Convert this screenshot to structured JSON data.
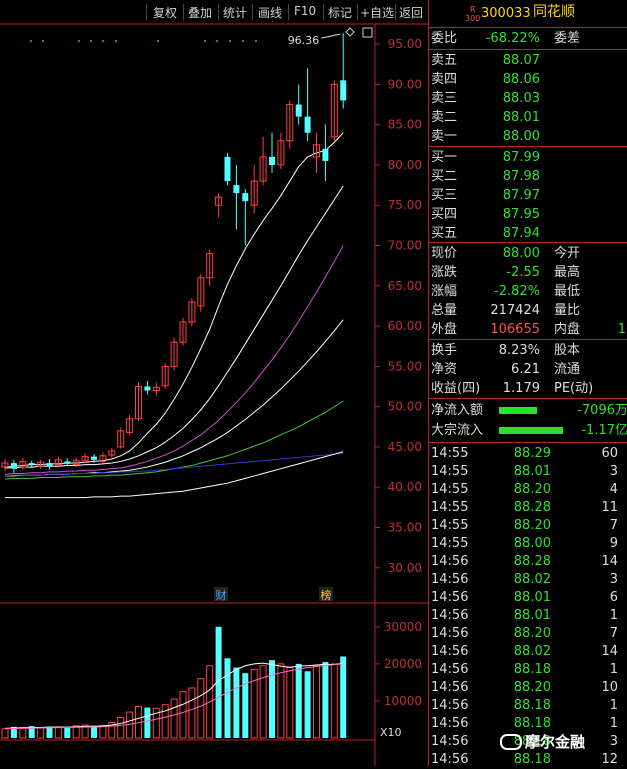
{
  "toolbar": {
    "buttons": [
      "复权",
      "叠加",
      "统计",
      "画线",
      "F10",
      "标记",
      "+自选",
      "返回"
    ]
  },
  "stock": {
    "badge_top": "R",
    "badge_bottom": "300",
    "code": "300033",
    "name": "同花顺"
  },
  "quote": {
    "ratio_label": "委比",
    "ratio_value": "-68.22%",
    "diff_label": "委差",
    "asks": [
      {
        "label": "卖五",
        "price": "88.07"
      },
      {
        "label": "卖四",
        "price": "88.06"
      },
      {
        "label": "卖三",
        "price": "88.03"
      },
      {
        "label": "卖二",
        "price": "88.01"
      },
      {
        "label": "卖一",
        "price": "88.00"
      }
    ],
    "bids": [
      {
        "label": "买一",
        "price": "87.99"
      },
      {
        "label": "买二",
        "price": "87.98"
      },
      {
        "label": "买三",
        "price": "87.97"
      },
      {
        "label": "买四",
        "price": "87.95"
      },
      {
        "label": "买五",
        "price": "87.94"
      }
    ],
    "stats": [
      {
        "label": "现价",
        "value": "88.00",
        "color": "#2ee02e",
        "label2": "今开",
        "value2": ""
      },
      {
        "label": "涨跌",
        "value": "-2.55",
        "color": "#2ee02e",
        "label2": "最高",
        "value2": ""
      },
      {
        "label": "涨幅",
        "value": "-2.82%",
        "color": "#2ee02e",
        "label2": "最低",
        "value2": ""
      },
      {
        "label": "总量",
        "value": "217424",
        "color": "#dddddd",
        "label2": "量比",
        "value2": ""
      },
      {
        "label": "外盘",
        "value": "106655",
        "color": "#ff5050",
        "label2": "内盘",
        "value2": "1"
      }
    ],
    "finance": [
      {
        "label": "换手",
        "value": "8.23%",
        "label2": "股本"
      },
      {
        "label": "净资",
        "value": "6.21",
        "label2": "流通"
      },
      {
        "label": "收益(四)",
        "value": "1.179",
        "label2": "PE(动)"
      }
    ],
    "flows": [
      {
        "label": "净流入额",
        "value": "-7096万"
      },
      {
        "label": "大宗流入",
        "value": "-1.17亿"
      }
    ]
  },
  "ticks": [
    {
      "time": "14:55",
      "price": "88.29",
      "vol": "60"
    },
    {
      "time": "14:55",
      "price": "88.01",
      "vol": "3"
    },
    {
      "time": "14:55",
      "price": "88.20",
      "vol": "4"
    },
    {
      "time": "14:55",
      "price": "88.28",
      "vol": "11"
    },
    {
      "time": "14:55",
      "price": "88.20",
      "vol": "7"
    },
    {
      "time": "14:55",
      "price": "88.00",
      "vol": "9"
    },
    {
      "time": "14:56",
      "price": "88.28",
      "vol": "14"
    },
    {
      "time": "14:56",
      "price": "88.02",
      "vol": "3"
    },
    {
      "time": "14:56",
      "price": "88.01",
      "vol": "6"
    },
    {
      "time": "14:56",
      "price": "88.01",
      "vol": "1"
    },
    {
      "time": "14:56",
      "price": "88.20",
      "vol": "7"
    },
    {
      "time": "14:56",
      "price": "88.02",
      "vol": "14"
    },
    {
      "time": "14:56",
      "price": "88.18",
      "vol": "1"
    },
    {
      "time": "14:56",
      "price": "88.20",
      "vol": "10"
    },
    {
      "time": "14:56",
      "price": "88.18",
      "vol": "1"
    },
    {
      "time": "14:56",
      "price": "88.18",
      "vol": "1"
    },
    {
      "time": "14:56",
      "price": "88.18",
      "vol": "3"
    },
    {
      "time": "14:56",
      "price": "88.18",
      "vol": "12"
    }
  ],
  "chart_data": [
    {
      "type": "candlestick",
      "price_axis_ticks": [
        "95.00",
        "90.00",
        "85.00",
        "80.00",
        "75.00",
        "70.00",
        "65.00",
        "60.00",
        "55.00",
        "50.00",
        "45.00",
        "40.00",
        "35.00",
        "30.00"
      ],
      "ylim": [
        26.0,
        97.0
      ],
      "max_label": "96.36",
      "event_markers": [
        "财",
        "榜"
      ],
      "candles": [
        {
          "o": 42.5,
          "c": 43.0,
          "h": 43.5,
          "l": 42.0
        },
        {
          "o": 43.0,
          "c": 42.3,
          "h": 43.4,
          "l": 41.8
        },
        {
          "o": 42.5,
          "c": 43.2,
          "h": 43.6,
          "l": 42.1
        },
        {
          "o": 43.0,
          "c": 42.8,
          "h": 43.3,
          "l": 42.4
        },
        {
          "o": 42.6,
          "c": 43.1,
          "h": 43.4,
          "l": 42.3
        },
        {
          "o": 43.0,
          "c": 42.6,
          "h": 43.5,
          "l": 42.2
        },
        {
          "o": 42.8,
          "c": 43.4,
          "h": 43.8,
          "l": 42.5
        },
        {
          "o": 43.2,
          "c": 42.9,
          "h": 43.6,
          "l": 42.6
        },
        {
          "o": 42.8,
          "c": 43.3,
          "h": 43.7,
          "l": 42.5
        },
        {
          "o": 43.3,
          "c": 43.8,
          "h": 44.2,
          "l": 43.0
        },
        {
          "o": 43.8,
          "c": 43.4,
          "h": 44.1,
          "l": 43.0
        },
        {
          "o": 43.2,
          "c": 43.9,
          "h": 44.3,
          "l": 43.0
        },
        {
          "o": 44.0,
          "c": 44.5,
          "h": 44.9,
          "l": 43.7
        },
        {
          "o": 45.0,
          "c": 47.0,
          "h": 47.4,
          "l": 44.8
        },
        {
          "o": 46.8,
          "c": 48.5,
          "h": 49.0,
          "l": 46.5
        },
        {
          "o": 48.5,
          "c": 52.5,
          "h": 53.0,
          "l": 48.2
        },
        {
          "o": 52.5,
          "c": 52.0,
          "h": 53.2,
          "l": 51.5
        },
        {
          "o": 52.0,
          "c": 52.4,
          "h": 53.0,
          "l": 51.4
        },
        {
          "o": 52.6,
          "c": 55.0,
          "h": 55.4,
          "l": 52.2
        },
        {
          "o": 55.0,
          "c": 58.0,
          "h": 58.6,
          "l": 54.5
        },
        {
          "o": 58.0,
          "c": 60.5,
          "h": 61.0,
          "l": 57.6
        },
        {
          "o": 60.5,
          "c": 63.0,
          "h": 63.5,
          "l": 60.0
        },
        {
          "o": 62.5,
          "c": 66.0,
          "h": 66.5,
          "l": 61.8
        },
        {
          "o": 66.0,
          "c": 69.0,
          "h": 69.5,
          "l": 65.0
        },
        {
          "o": 75.0,
          "c": 76.0,
          "h": 76.5,
          "l": 73.5
        },
        {
          "o": 81.0,
          "c": 78.0,
          "h": 81.5,
          "l": 77.5
        },
        {
          "o": 77.5,
          "c": 76.5,
          "h": 80.0,
          "l": 72.0
        },
        {
          "o": 76.5,
          "c": 75.5,
          "h": 77.0,
          "l": 70.0
        },
        {
          "o": 75.0,
          "c": 78.0,
          "h": 80.0,
          "l": 74.0
        },
        {
          "o": 78.0,
          "c": 81.0,
          "h": 83.5,
          "l": 77.5
        },
        {
          "o": 81.0,
          "c": 80.0,
          "h": 84.0,
          "l": 79.0
        },
        {
          "o": 80.0,
          "c": 83.0,
          "h": 84.0,
          "l": 79.5
        },
        {
          "o": 83.0,
          "c": 87.5,
          "h": 88.0,
          "l": 82.0
        },
        {
          "o": 87.5,
          "c": 86.0,
          "h": 90.0,
          "l": 85.0
        },
        {
          "o": 86.0,
          "c": 84.0,
          "h": 92.0,
          "l": 83.0
        },
        {
          "o": 81.0,
          "c": 82.5,
          "h": 84.0,
          "l": 79.0
        },
        {
          "o": 82.0,
          "c": 80.5,
          "h": 85.0,
          "l": 78.0
        },
        {
          "o": 83.5,
          "c": 90.0,
          "h": 90.5,
          "l": 83.0
        },
        {
          "o": 90.5,
          "c": 88.0,
          "h": 96.36,
          "l": 87.0
        }
      ],
      "ma_series": [
        {
          "color": "#ffffff",
          "values": [
            42.5,
            42.6,
            42.7,
            42.8,
            42.8,
            42.9,
            42.9,
            43.0,
            43.0,
            43.1,
            43.2,
            43.3,
            43.5,
            43.9,
            44.5,
            45.5,
            46.7,
            47.8,
            49.2,
            50.9,
            52.8,
            54.9,
            57.2,
            59.6,
            62.5,
            65.2,
            67.5,
            69.6,
            71.4,
            73.1,
            74.6,
            76.2,
            78.0,
            79.8,
            81.0,
            81.5,
            81.8,
            82.8,
            84.0
          ]
        },
        {
          "color": "#ffffff",
          "values": [
            42.4,
            42.4,
            42.5,
            42.5,
            42.6,
            42.6,
            42.6,
            42.7,
            42.7,
            42.8,
            42.8,
            42.9,
            43.0,
            43.2,
            43.5,
            43.9,
            44.4,
            44.9,
            45.6,
            46.4,
            47.3,
            48.4,
            49.6,
            51.0,
            52.6,
            54.3,
            56.0,
            57.8,
            59.6,
            61.4,
            63.2,
            65.0,
            66.9,
            68.8,
            70.6,
            72.3,
            74.0,
            75.7,
            77.4
          ]
        },
        {
          "color": "#d04cd0",
          "values": [
            41.6,
            41.7,
            41.7,
            41.8,
            41.8,
            41.9,
            41.9,
            42.0,
            42.0,
            42.1,
            42.1,
            42.2,
            42.3,
            42.4,
            42.6,
            42.9,
            43.2,
            43.6,
            44.0,
            44.5,
            45.1,
            45.8,
            46.5,
            47.4,
            48.3,
            49.4,
            50.5,
            51.7,
            53.0,
            54.4,
            55.8,
            57.3,
            58.9,
            60.6,
            62.4,
            64.2,
            66.1,
            68.0,
            70.0
          ]
        },
        {
          "color": "#ffffff",
          "values": [
            41.4,
            41.4,
            41.5,
            41.5,
            41.5,
            41.6,
            41.6,
            41.6,
            41.7,
            41.7,
            41.8,
            41.8,
            41.9,
            42.0,
            42.1,
            42.3,
            42.5,
            42.8,
            43.1,
            43.5,
            43.9,
            44.4,
            44.9,
            45.5,
            46.1,
            46.8,
            47.6,
            48.4,
            49.3,
            50.2,
            51.2,
            52.2,
            53.3,
            54.4,
            55.6,
            56.8,
            58.1,
            59.4,
            60.8
          ]
        },
        {
          "color": "#44c044",
          "values": [
            41.0,
            41.1,
            41.1,
            41.1,
            41.2,
            41.2,
            41.2,
            41.3,
            41.3,
            41.3,
            41.4,
            41.4,
            41.5,
            41.5,
            41.6,
            41.7,
            41.8,
            41.9,
            42.1,
            42.3,
            42.5,
            42.7,
            43.0,
            43.3,
            43.6,
            43.9,
            44.3,
            44.7,
            45.1,
            45.5,
            46.0,
            46.5,
            47.0,
            47.5,
            48.1,
            48.7,
            49.3,
            50.0,
            50.7
          ]
        },
        {
          "color": "#3838d0",
          "values": [
            41.4,
            41.5,
            41.5,
            41.5,
            41.5,
            41.6,
            41.6,
            41.6,
            41.7,
            41.7,
            41.7,
            41.8,
            41.8,
            41.9,
            41.9,
            42.0,
            42.0,
            42.1,
            42.2,
            42.3,
            42.4,
            42.5,
            42.6,
            42.7,
            42.8,
            42.9,
            43.0,
            43.1,
            43.2,
            43.3,
            43.4,
            43.5,
            43.6,
            43.7,
            43.8,
            43.9,
            44.0,
            44.1,
            44.2
          ]
        },
        {
          "color": "#ffffff",
          "values": [
            38.7,
            38.7,
            38.7,
            38.7,
            38.7,
            38.7,
            38.7,
            38.7,
            38.7,
            38.7,
            38.8,
            38.8,
            38.8,
            38.9,
            38.9,
            39.0,
            39.1,
            39.2,
            39.3,
            39.4,
            39.5,
            39.7,
            39.9,
            40.1,
            40.3,
            40.5,
            40.8,
            41.1,
            41.4,
            41.7,
            42.0,
            42.3,
            42.6,
            42.9,
            43.2,
            43.5,
            43.8,
            44.1,
            44.4
          ]
        }
      ]
    },
    {
      "type": "bar",
      "volume_axis_ticks": [
        "30000",
        "20000",
        "10000"
      ],
      "unit_label": "X10",
      "ylim": [
        0,
        34000
      ],
      "values": [
        2500,
        3000,
        2800,
        3200,
        2700,
        3100,
        3000,
        2900,
        3300,
        3500,
        3200,
        3400,
        4200,
        5500,
        7000,
        8500,
        8200,
        8000,
        9000,
        10500,
        12500,
        13500,
        16000,
        19500,
        30000,
        21500,
        19000,
        17500,
        18500,
        19500,
        21000,
        20000,
        19000,
        20000,
        18000,
        19500,
        20500,
        20000,
        22000
      ],
      "up": [
        true,
        false,
        true,
        false,
        true,
        false,
        true,
        false,
        true,
        true,
        false,
        true,
        true,
        true,
        true,
        true,
        false,
        true,
        true,
        true,
        true,
        true,
        true,
        true,
        false,
        false,
        false,
        false,
        true,
        true,
        false,
        true,
        true,
        false,
        false,
        true,
        false,
        true,
        false
      ],
      "ma_lines": [
        {
          "color": "#ffffff",
          "values": [
            2600,
            2700,
            2750,
            2850,
            2850,
            2950,
            2950,
            2950,
            3050,
            3150,
            3200,
            3250,
            3500,
            3900,
            4600,
            5300,
            6000,
            6700,
            7300,
            8200,
            9100,
            10200,
            11400,
            13000,
            15500,
            17000,
            18500,
            19500,
            20000,
            20200,
            19800,
            19400,
            19100,
            19400,
            19500,
            19700,
            19900,
            19800,
            20200
          ]
        },
        {
          "color": "#ff66cc",
          "values": [
            2500,
            2550,
            2600,
            2650,
            2700,
            2750,
            2800,
            2850,
            2900,
            2950,
            3000,
            3050,
            3200,
            3400,
            3700,
            4100,
            4600,
            5100,
            5600,
            6200,
            6900,
            7700,
            8600,
            9700,
            11000,
            12300,
            13500,
            14600,
            15500,
            16300,
            17000,
            17600,
            18100,
            18600,
            19000,
            19300,
            19600,
            19800,
            20000
          ]
        }
      ]
    }
  ]
}
